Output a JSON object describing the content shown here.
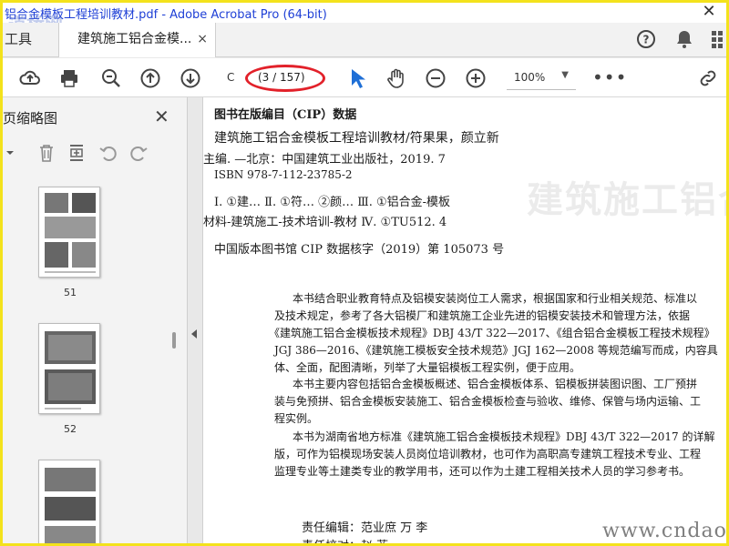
{
  "window": {
    "title": "铝合金模板工程培训教材.pdf - Adobe Acrobat Pro (64-bit)",
    "close_glyph": "✕"
  },
  "tabs": {
    "tools_label": "工具",
    "doc_tab_label": "建筑施工铝合金模...",
    "doc_tab_close": "×"
  },
  "toolbar": {
    "page_prefix": "C",
    "page_indicator": "(3 / 157)",
    "zoom": "100%",
    "zoom_caret": "▼",
    "more": "•••",
    "annotation_color": "#e2212a",
    "accent": "#1f6fd6"
  },
  "thumbpanel": {
    "title": "页缩略图",
    "close": "✕",
    "pages": [
      "51",
      "52"
    ]
  },
  "document": {
    "cip_title": "图书在版编目（CIP）数据",
    "line1": "建筑施工铝合金模板工程培训教材/符果果，颜立新",
    "line2": "主编. —北京：中国建筑工业出版社，2019. 7",
    "line3": "ISBN 978-7-112-23785-2",
    "line4": "Ⅰ. ①建…   Ⅱ. ①符…  ②颜…   Ⅲ. ①铝合金-模板",
    "line5": "材料-建筑施工-技术培训-教材   Ⅳ. ①TU512. 4",
    "line6": "中国版本图书馆 CIP 数据核字（2019）第 105073 号",
    "para1": [
      "本书结合职业教育特点及铝模安装岗位工人需求，根据国家和行业相关规范、标准以",
      "及技术规定，参考了各大铝模厂和建筑施工企业先进的铝模安装技术和管理方法，依据",
      "《建筑施工铝合金模板技术规程》DBJ 43/T 322—2017、《组合铝合金模板工程技术规程》",
      "JGJ 386—2016、《建筑施工模板安全技术规范》JGJ 162—2008 等规范编写而成，内容具",
      "体、全面，配图清晰，列举了大量铝模板工程实例，便于应用。"
    ],
    "para2": [
      "本书主要内容包括铝合金模板概述、铝合金模板体系、铝模板拼装图识图、工厂预拼",
      "装与免预拼、铝合金模板安装施工、铝合金模板检查与验收、维修、保管与场内运输、工",
      "程实例。"
    ],
    "para3": [
      "本书为湖南省地方标准《建筑施工铝合金模板技术规程》DBJ 43/T 322—2017 的详解",
      "版，可作为铝模现场安装人员岗位培训教材，也可作为高职高专建筑工程技术专业、工程",
      "监理专业等土建类专业的教学用书，还可以作为土建工程相关技术人员的学习参考书。"
    ],
    "editor1": "责任编辑：范业庶    万   李",
    "editor2": "责任校对：赵    菲",
    "watermark_big": "建筑施工铝合金模板工"
  },
  "watermarks": {
    "cndao": "www.cndao.com",
    "logo": "道桥网"
  }
}
